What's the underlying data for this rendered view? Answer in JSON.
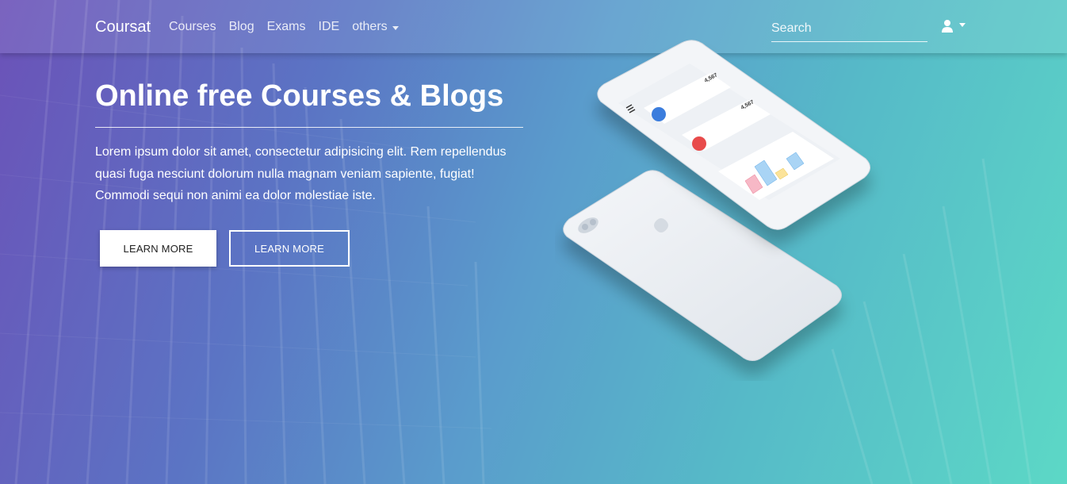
{
  "navbar": {
    "brand": "Coursat",
    "links": [
      {
        "label": "Courses"
      },
      {
        "label": "Blog"
      },
      {
        "label": "Exams"
      },
      {
        "label": "IDE"
      },
      {
        "label": "others"
      }
    ],
    "search_placeholder": "Search"
  },
  "hero": {
    "title": "Online free Courses & Blogs",
    "description": "Lorem ipsum dolor sit amet, consectetur adipisicing elit. Rem repellendus quasi fuga nesciunt dolorum nulla magnam veniam sapiente, fugiat! Commodi sequi non animi ea dolor molestiae iste.",
    "button_primary": "LEARN MORE",
    "button_secondary": "LEARN MORE"
  },
  "phone_screen": {
    "card1_value": "4,567",
    "card2_value": "4,567"
  },
  "colors": {
    "gradient_left": "#6b52b8",
    "gradient_right": "#5cd8c6",
    "card_blue": "#3b7ddd",
    "card_red": "#e84b4b"
  },
  "icons": [
    "user-icon",
    "caret-down-icon",
    "hamburger-icon",
    "apple-logo-icon"
  ]
}
